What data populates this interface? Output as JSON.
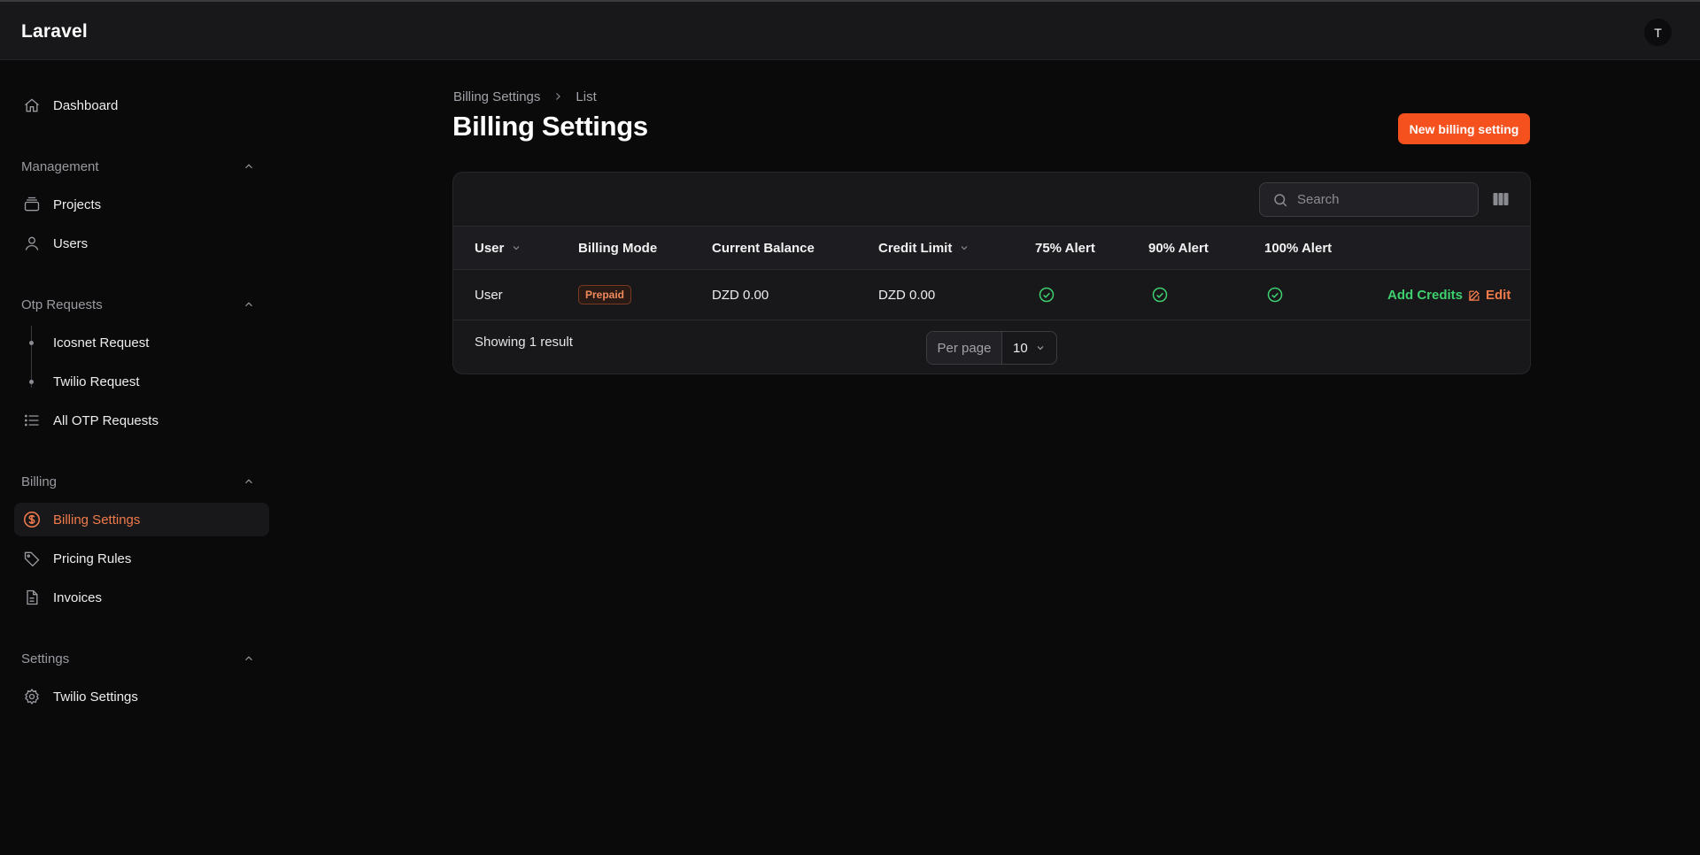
{
  "app": {
    "brand": "Laravel",
    "avatar_initial": "T"
  },
  "sidebar": {
    "dashboard": {
      "label": "Dashboard",
      "icon": "home-icon"
    },
    "groups": {
      "management": {
        "label": "Management",
        "items": {
          "projects": "Projects",
          "users": "Users"
        }
      },
      "otp": {
        "label": "Otp Requests",
        "items": {
          "icosnet": "Icosnet Request",
          "twilio": "Twilio Request",
          "all": "All OTP Requests"
        }
      },
      "billing": {
        "label": "Billing",
        "items": {
          "settings": "Billing Settings",
          "pricing": "Pricing Rules",
          "invoices": "Invoices"
        }
      },
      "settings": {
        "label": "Settings",
        "items": {
          "twilio": "Twilio Settings"
        }
      }
    }
  },
  "breadcrumb": {
    "parent": "Billing Settings",
    "current": "List"
  },
  "page": {
    "title": "Billing Settings",
    "new_button": "New billing setting"
  },
  "table": {
    "search_placeholder": "Search",
    "columns": {
      "user": "User",
      "billing_mode": "Billing Mode",
      "current_balance": "Current Balance",
      "credit_limit": "Credit Limit",
      "alert75": "75% Alert",
      "alert90": "90% Alert",
      "alert100": "100% Alert"
    },
    "rows": [
      {
        "user": "User",
        "billing_mode": "Prepaid",
        "current_balance": "DZD 0.00",
        "credit_limit": "DZD 0.00",
        "alert75": true,
        "alert90": true,
        "alert100": true,
        "add_credits": "Add Credits",
        "edit": "Edit"
      }
    ],
    "footer": {
      "summary": "Showing 1 result",
      "per_page_label": "Per page",
      "per_page_value": "10"
    }
  },
  "colors": {
    "accent": "#f4511e",
    "active_nav": "#f07a4a",
    "success": "#3ecf6e",
    "background": "#0a0a0b",
    "surface": "#18181b"
  }
}
